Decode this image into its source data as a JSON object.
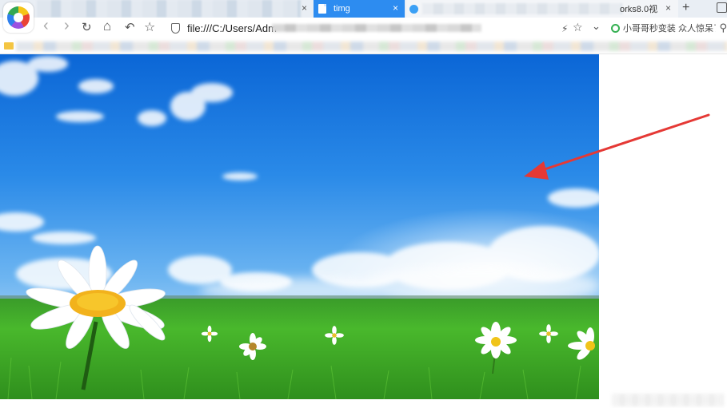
{
  "tabs": {
    "active": {
      "title": "timg"
    },
    "third": {
      "title": "orks8.0视"
    },
    "close_glyph": "×",
    "new_tab_glyph": "+"
  },
  "toolbar": {
    "back_glyph": "‹",
    "forward_glyph": "›",
    "reload_glyph": "↻",
    "home_glyph": "⌂",
    "undo_glyph": "↶",
    "star_glyph": "☆",
    "url": "file:///C:/Users/Adm",
    "lightning_glyph": "⚡",
    "star2_glyph": "☆",
    "dropdown_glyph": "⌄",
    "search_text": "小哥哥秒变装 众人惊呆了",
    "search_glyph": "⚲"
  },
  "colors": {
    "tab_active": "#2d8cf0",
    "arrow": "#e53935"
  },
  "icons": [
    "app-logo-icon",
    "doc-icon",
    "shield-icon",
    "back-icon",
    "forward-icon",
    "reload-icon",
    "home-icon",
    "undo-icon",
    "star-icon",
    "lightning-icon",
    "search-engine-icon",
    "search-icon",
    "folder-icon",
    "shirt-icon"
  ]
}
